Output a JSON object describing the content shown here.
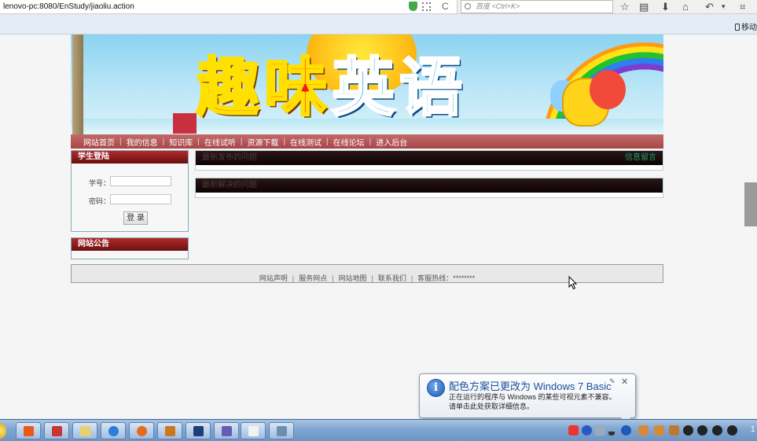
{
  "browser": {
    "url": "lenovo-pc:8080/EnStudy/jiaoliu.action",
    "search_placeholder": "百度 <Ctrl+K>",
    "reload_glyph": "C",
    "bookmark_mobile": "移动"
  },
  "banner": {
    "title_part1": "趣味",
    "title_part2": "英语"
  },
  "nav": {
    "items": [
      {
        "label": "网站首页"
      },
      {
        "label": "我的信息"
      },
      {
        "label": "知识库"
      },
      {
        "label": "在线试听"
      },
      {
        "label": "资源下载"
      },
      {
        "label": "在线测试"
      },
      {
        "label": "在线论坛"
      },
      {
        "label": "进入后台"
      }
    ],
    "separator": "|"
  },
  "login": {
    "title": "学生登陆",
    "id_label": "学号：",
    "pwd_label": "密码：",
    "id_value": "",
    "pwd_value": "",
    "button_label": "登 录"
  },
  "notice": {
    "title": "网站公告"
  },
  "panels": {
    "latest_questions": "最新发布的问题",
    "message_link": "信息留言",
    "solved_questions": "最新解决的问题"
  },
  "footer": {
    "statement": "网站声明",
    "service": "服务网点",
    "sitemap": "网站地图",
    "contact": "联系我们",
    "hotline": "客服热线：********",
    "separator": "|"
  },
  "notification": {
    "title": "配色方案已更改为 Windows 7 Basic",
    "line1": "正在运行的程序与 Windows 的某些可视元素不兼容。",
    "line2": "请单击此处获取详细信息。",
    "close": "✕",
    "info_glyph": "i"
  },
  "taskbar": {
    "time_fragment": "1"
  },
  "colors": {
    "nav_bg": "#b35555",
    "box_head": "#8b1a1a",
    "panel_head": "#1a0a0a",
    "taskbar": "#7fa5d1"
  }
}
